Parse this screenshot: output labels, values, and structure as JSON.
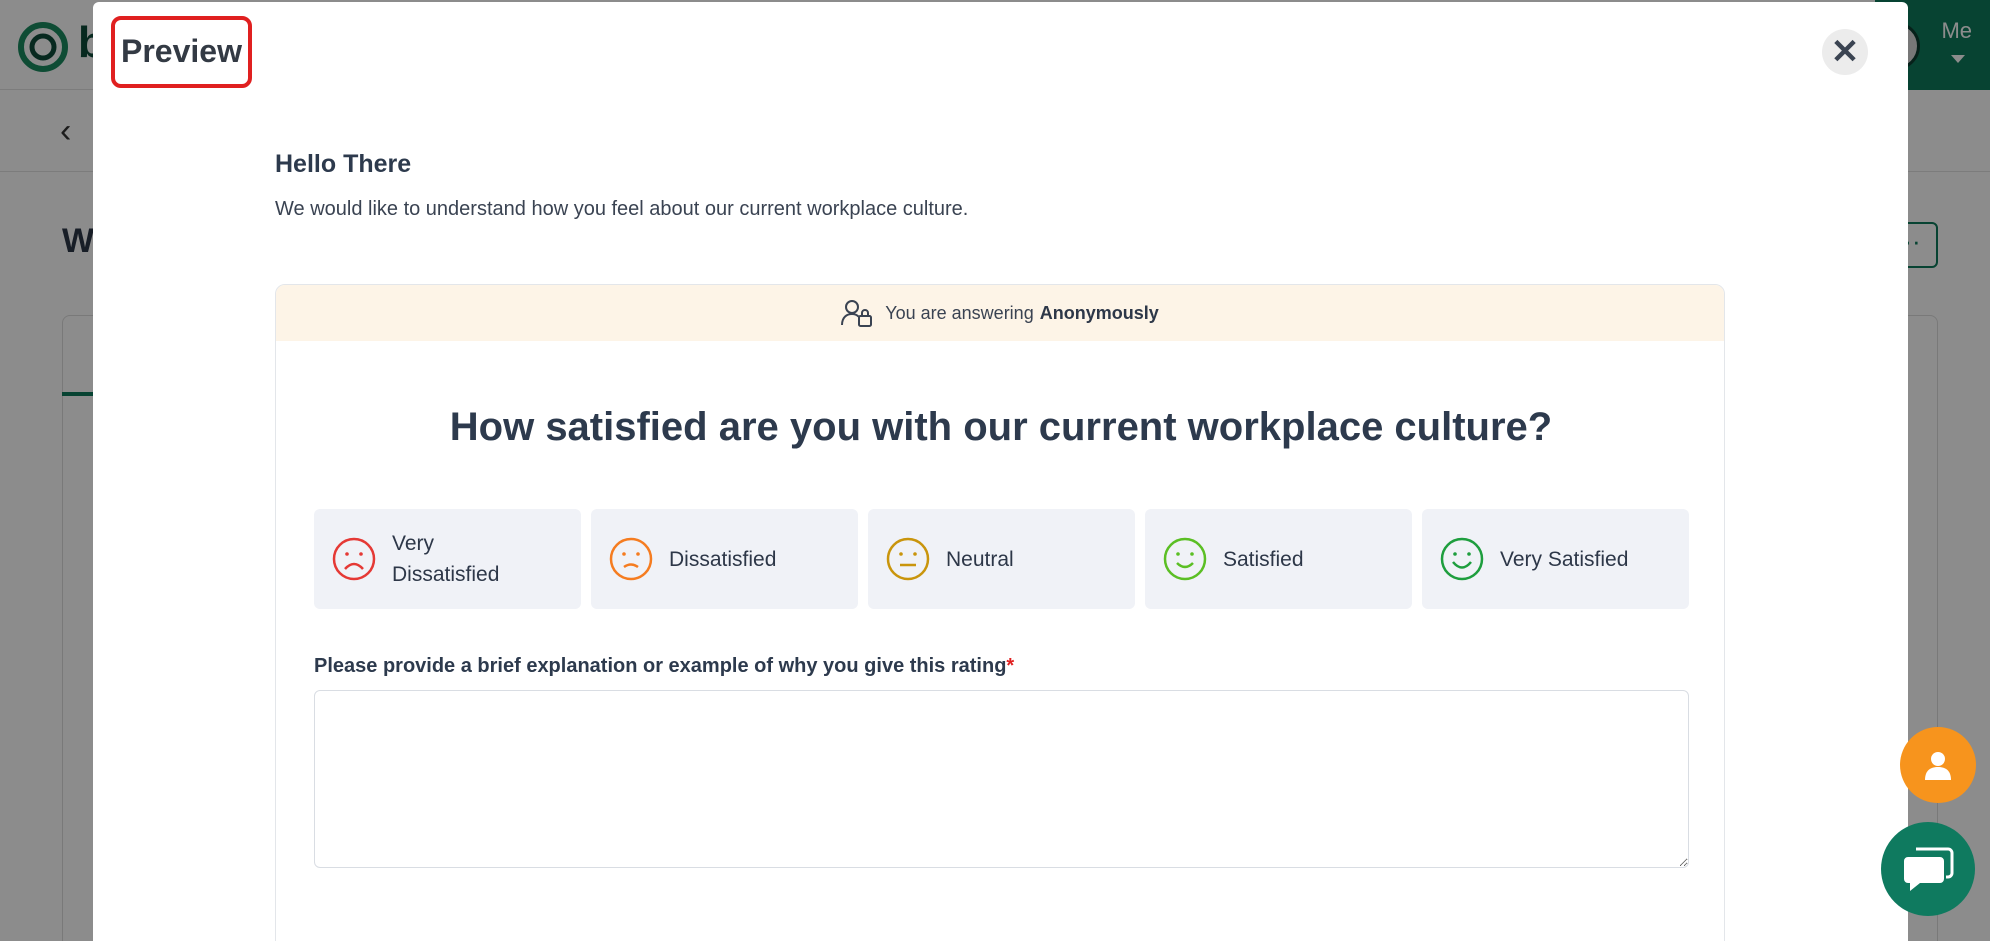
{
  "background_app": {
    "logo_letter": "b",
    "user_menu_label": "Me",
    "page_title_partial": "W",
    "more_button_label": "··"
  },
  "modal": {
    "title": "Preview",
    "close_label": "✕",
    "greeting": "Hello There",
    "intro": "We would like to understand how you feel about our current workplace culture.",
    "anonymous_notice": {
      "prefix": "You are answering",
      "emphasis": "Anonymously"
    },
    "question": "How satisfied are you with our current workplace culture?",
    "options": [
      {
        "label": "Very Dissatisfied",
        "icon": "very-dissatisfied-face-icon",
        "color": "#e53935"
      },
      {
        "label": "Dissatisfied",
        "icon": "dissatisfied-face-icon",
        "color": "#f57c20"
      },
      {
        "label": "Neutral",
        "icon": "neutral-face-icon",
        "color": "#c9950c"
      },
      {
        "label": "Satisfied",
        "icon": "satisfied-face-icon",
        "color": "#5bbf24"
      },
      {
        "label": "Very Satisfied",
        "icon": "very-satisfied-face-icon",
        "color": "#1e9e3e"
      }
    ],
    "explanation_label": "Please provide a brief explanation or example of why you give this rating",
    "required_marker": "*",
    "explanation_value": ""
  },
  "floating": {
    "user_button_icon": "user-icon",
    "chat_button_icon": "chat-icon"
  },
  "colors": {
    "brand_green": "#0e7a5c",
    "highlight_red": "#e02020",
    "anon_bar_bg": "#fdf4e7",
    "fab_orange": "#f7941d"
  }
}
